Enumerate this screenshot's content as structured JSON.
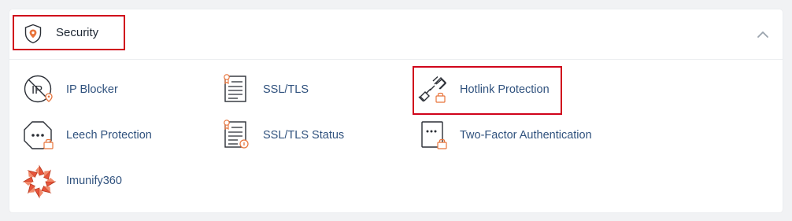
{
  "section": {
    "title": "Security",
    "icon": "shield-icon",
    "collapse_icon": "chevron-up-icon"
  },
  "items": [
    {
      "label": "IP Blocker",
      "icon": "ip-blocker-icon"
    },
    {
      "label": "SSL/TLS",
      "icon": "certificate-icon"
    },
    {
      "label": "Hotlink Protection",
      "icon": "broken-link-icon"
    },
    {
      "label": "Leech Protection",
      "icon": "leech-protection-icon"
    },
    {
      "label": "SSL/TLS Status",
      "icon": "certificate-status-icon"
    },
    {
      "label": "Two-Factor Authentication",
      "icon": "two-factor-icon"
    },
    {
      "label": "Imunify360",
      "icon": "imunify360-logo-icon"
    }
  ],
  "colors": {
    "accent_orange": "#e8743b",
    "link_blue": "#30527e",
    "highlight_red": "#d0021b"
  }
}
